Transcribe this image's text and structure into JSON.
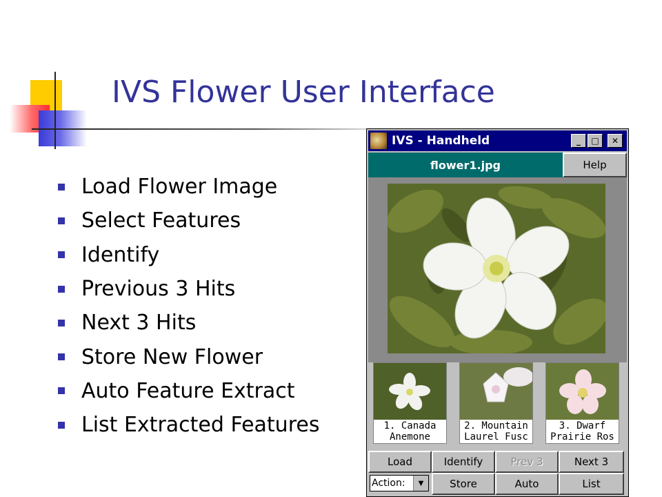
{
  "slide": {
    "title": "IVS Flower User Interface",
    "bullets": [
      "Load Flower Image",
      "Select Features",
      "Identify",
      "Previous 3 Hits",
      "Next 3 Hits",
      "Store New Flower",
      "Auto Feature Extract",
      "List Extracted Features"
    ]
  },
  "window": {
    "title": "IVS - Handheld",
    "controls": {
      "minimize": "_",
      "maximize": "□",
      "close": "✕"
    },
    "file_name": "flower1.jpg",
    "help_label": "Help",
    "thumbnails": [
      {
        "line1": "1. Canada",
        "line2": "Anemone"
      },
      {
        "line1": "2. Mountain",
        "line2": "Laurel Fusc"
      },
      {
        "line1": "3. Dwarf",
        "line2": "Prairie Ros"
      }
    ],
    "buttons": {
      "load": "Load",
      "identify": "Identify",
      "prev": "Prev 3",
      "next": "Next 3",
      "store": "Store",
      "auto": "Auto",
      "list": "List"
    },
    "action_label": "Action:",
    "action_arrow": "▼"
  },
  "colors": {
    "title": "#333399",
    "bullet": "#3333aa",
    "titlebar": "#000080",
    "filebar": "#006b6b"
  }
}
